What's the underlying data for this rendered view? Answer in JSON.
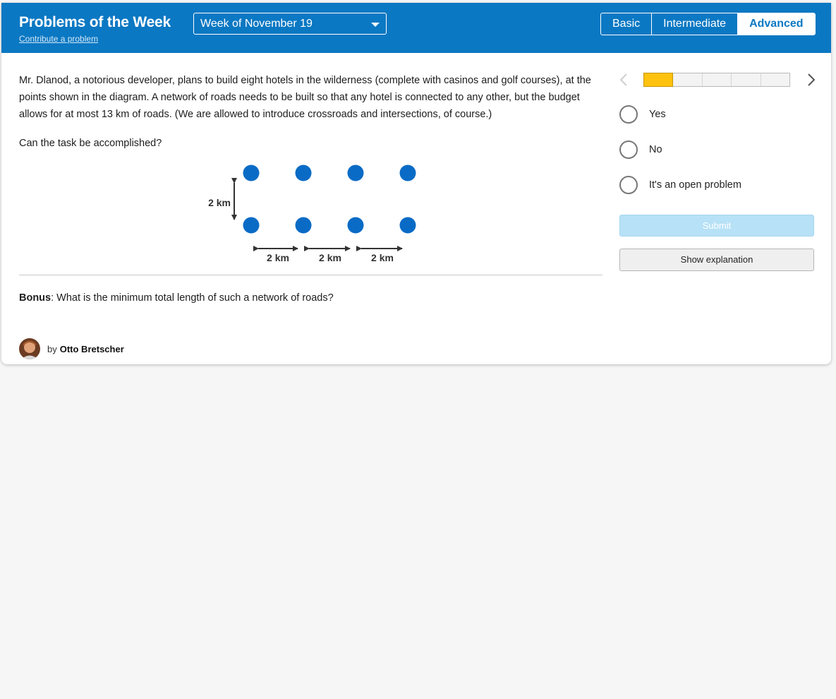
{
  "header": {
    "title": "Problems of the Week",
    "contribute_link": "Contribute a problem",
    "week_select": "Week of November 19",
    "levels": [
      "Basic",
      "Intermediate",
      "Advanced"
    ],
    "active_level": "Advanced"
  },
  "problem": {
    "text": "Mr. Dlanod, a notorious developer, plans to build eight hotels in the wilderness (complete with casinos and golf courses), at the points shown in the diagram. A network of roads needs to be built so that any hotel is connected to any other, but the budget allows for at most 13 km of roads. (We are allowed to introduce crossroads and intersections, of course.)",
    "question": "Can the task be accomplished?",
    "diagram": {
      "vertical_label": "2 km",
      "horizontal_labels": [
        "2 km",
        "2 km",
        "2 km"
      ],
      "hotel_color": "#0a6bc6"
    },
    "bonus_label": "Bonus",
    "bonus_text": ": What is the minimum total length of such a network of roads?"
  },
  "author": {
    "by": "by",
    "name": "Otto Bretscher"
  },
  "progress": {
    "completed": 1,
    "total": 5,
    "fill_color": "#ffc20e"
  },
  "options": [
    "Yes",
    "No",
    "It's an open problem"
  ],
  "buttons": {
    "submit": "Submit",
    "explanation": "Show explanation"
  }
}
